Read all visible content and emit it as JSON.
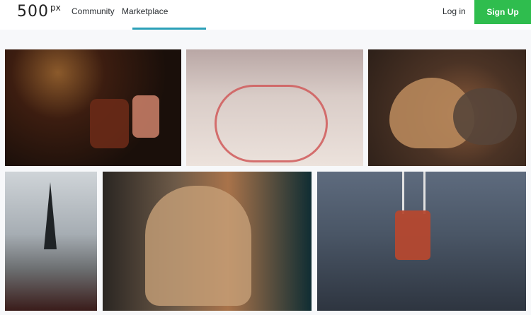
{
  "header": {
    "logo_digits": "500",
    "logo_suffix": "px",
    "links": [
      "Community",
      "Marketplace"
    ],
    "active_link": "Marketplace",
    "login": "Log in",
    "signup": "Sign Up"
  },
  "gallery": {
    "tiles": [
      {
        "name": "photo-drinks"
      },
      {
        "name": "photo-bicycle"
      },
      {
        "name": "photo-dog-cat"
      },
      {
        "name": "photo-eiffel-tower-selfie"
      },
      {
        "name": "photo-girl-window"
      },
      {
        "name": "photo-camera-sweater"
      }
    ]
  },
  "colors": {
    "accent_blue": "#2ba0b8",
    "signup_green": "#2fbd4e",
    "background": "#f7f8fa"
  }
}
